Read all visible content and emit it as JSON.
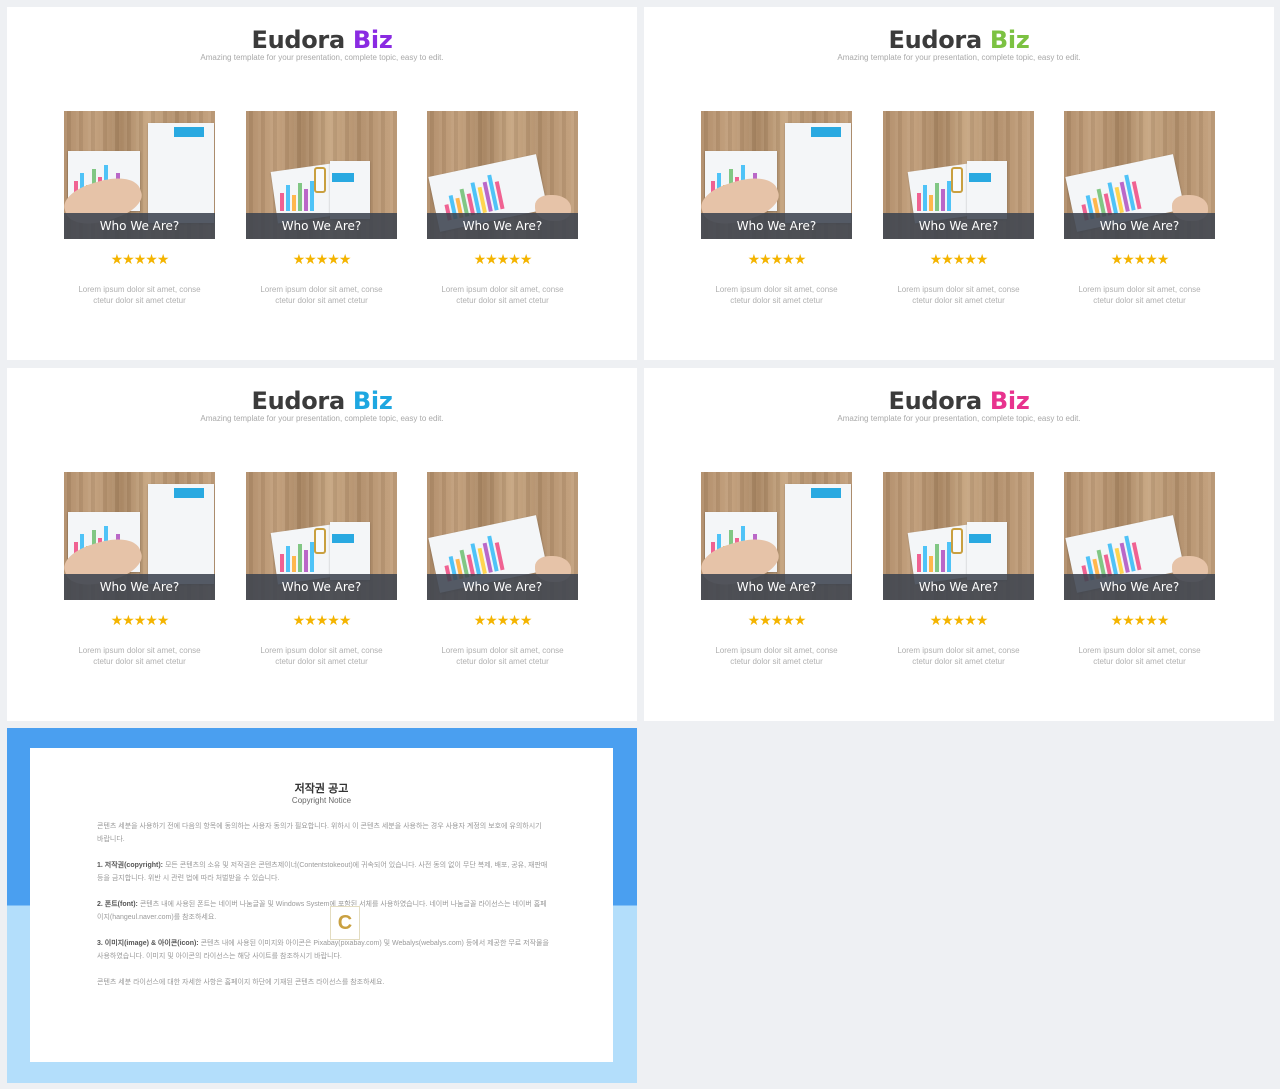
{
  "slides": [
    {
      "title_main": "Eudora",
      "title_accent": "Biz",
      "accent_color": "#8a2be2",
      "subtitle": "Amazing template for your presentation, complete topic, easy to edit."
    },
    {
      "title_main": "Eudora",
      "title_accent": "Biz",
      "accent_color": "#7cc242",
      "subtitle": "Amazing template for your presentation, complete topic, easy to edit."
    },
    {
      "title_main": "Eudora",
      "title_accent": "Biz",
      "accent_color": "#1ea7e1",
      "subtitle": "Amazing template for your presentation, complete topic, easy to edit."
    },
    {
      "title_main": "Eudora",
      "title_accent": "Biz",
      "accent_color": "#e8338e",
      "subtitle": "Amazing template for your presentation, complete topic, easy to edit."
    }
  ],
  "card": {
    "caption": "Who We Are?",
    "stars": "★★★★★",
    "desc_line1": "Lorem ipsum dolor sit amet, conse",
    "desc_line2": "ctetur dolor sit amet  ctetur"
  },
  "watermark": "C",
  "notice": {
    "title": "저작권 공고",
    "subtitle": "Copyright Notice",
    "intro": "콘텐츠 세분을 사용하기 전에 다음의 항목에 동의하는 사용자 동의가 필요합니다. 위하시 이 콘텐츠 세분을 사용하는 경우 사용자 계정의 보호에 유의하시기 바랍니다.",
    "s1_head": "1. 저작권(copyright):",
    "s1_text": " 모든 콘텐츠의 소유 및 저작권은 콘텐츠제이너(Contentstokeout)에 귀속되어 있습니다. 사전 동의 없이 무단 복제, 배포, 공유, 재판매 등을 금지합니다. 위반 시 관련 법에 따라 처벌받을 수 있습니다.",
    "s2_head": "2. 폰트(font):",
    "s2_text": " 콘텐츠 내에 사용된 폰트는 네이버 나눔글꼴 및 Windows System에 포함된 서체를 사용하였습니다. 네이버 나눔글꼴 라이선스는 네이버 홈페이지(hangeul.naver.com)를 참조하세요.",
    "s3_head": "3. 이미지(image) & 아이콘(icon):",
    "s3_text": " 콘텐츠 내에 사용된 이미지와 아이콘은 Pixabay(pixabay.com) 및 Webalys(webalys.com) 등에서 제공한 무료 저작물을 사용하였습니다. 이미지 및 아이콘의 라이선스는 해당 사이트를 참조하시기 바랍니다.",
    "outro": "콘텐츠 세분 라이선스에 대한 자세한 사항은 홈페이지 하단에 기재된 콘텐츠 라이선스를 참조하세요."
  }
}
